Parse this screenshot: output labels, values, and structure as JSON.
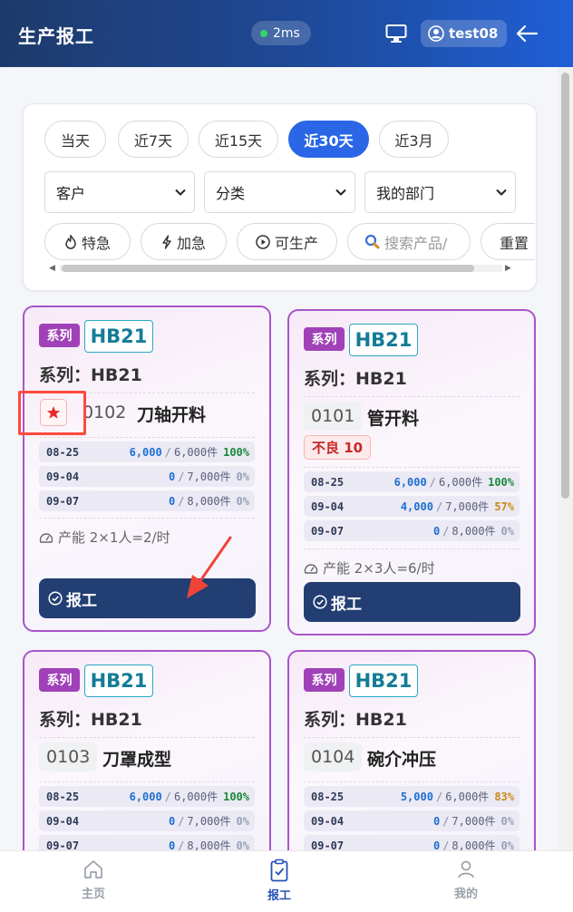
{
  "header": {
    "title": "生产报工",
    "latency": "2ms",
    "user": "test08",
    "colors": {
      "start": "#1e3a6b",
      "end": "#1f5fd6",
      "status_dot": "#35d46a"
    }
  },
  "filters": {
    "ranges": [
      {
        "label": "当天",
        "active": false
      },
      {
        "label": "近7天",
        "active": false
      },
      {
        "label": "近15天",
        "active": false
      },
      {
        "label": "近30天",
        "active": true
      },
      {
        "label": "近3月",
        "active": false
      }
    ],
    "selects": {
      "customer": "客户",
      "category": "分类",
      "department": "我的部门"
    },
    "chips": {
      "special": "特急",
      "urgent": "加急",
      "producible": "可生产",
      "search_placeholder": "搜索产品/",
      "more": "重置"
    }
  },
  "cards": [
    {
      "series_badge": "系列",
      "code": "HB21",
      "series_line": "系列：HB21",
      "proc_code": "0102",
      "proc_name": "刀轴开料",
      "starred": true,
      "rows": [
        {
          "date": "08-25",
          "done": "6,000",
          "total": "6,000件",
          "pct": "100%"
        },
        {
          "date": "09-04",
          "done": "0",
          "total": "7,000件",
          "pct": "0%"
        },
        {
          "date": "09-07",
          "done": "0",
          "total": "8,000件",
          "pct": "0%"
        }
      ],
      "capacity": "产能 2×1人=2/时",
      "action": "报工"
    },
    {
      "series_badge": "系列",
      "code": "HB21",
      "series_line": "系列：HB21",
      "proc_code": "0101",
      "proc_name": "管开料",
      "defect": "不良 10",
      "rows": [
        {
          "date": "08-25",
          "done": "6,000",
          "total": "6,000件",
          "pct": "100%"
        },
        {
          "date": "09-04",
          "done": "4,000",
          "total": "7,000件",
          "pct": "57%"
        },
        {
          "date": "09-07",
          "done": "0",
          "total": "8,000件",
          "pct": "0%"
        }
      ],
      "capacity": "产能 2×3人=6/时",
      "action": "报工"
    },
    {
      "series_badge": "系列",
      "code": "HB21",
      "series_line": "系列：HB21",
      "proc_code": "0103",
      "proc_name": "刀罩成型",
      "rows": [
        {
          "date": "08-25",
          "done": "6,000",
          "total": "6,000件",
          "pct": "100%"
        },
        {
          "date": "09-04",
          "done": "0",
          "total": "7,000件",
          "pct": "0%"
        },
        {
          "date": "09-07",
          "done": "0",
          "total": "8,000件",
          "pct": "0%"
        }
      ]
    },
    {
      "series_badge": "系列",
      "code": "HB21",
      "series_line": "系列：HB21",
      "proc_code": "0104",
      "proc_name": "碗介冲压",
      "rows": [
        {
          "date": "08-25",
          "done": "5,000",
          "total": "6,000件",
          "pct": "83%"
        },
        {
          "date": "09-04",
          "done": "0",
          "total": "7,000件",
          "pct": "0%"
        },
        {
          "date": "09-07",
          "done": "0",
          "total": "8,000件",
          "pct": "0%"
        }
      ]
    }
  ],
  "nav": {
    "home": "主页",
    "report": "报工",
    "mine": "我的"
  }
}
